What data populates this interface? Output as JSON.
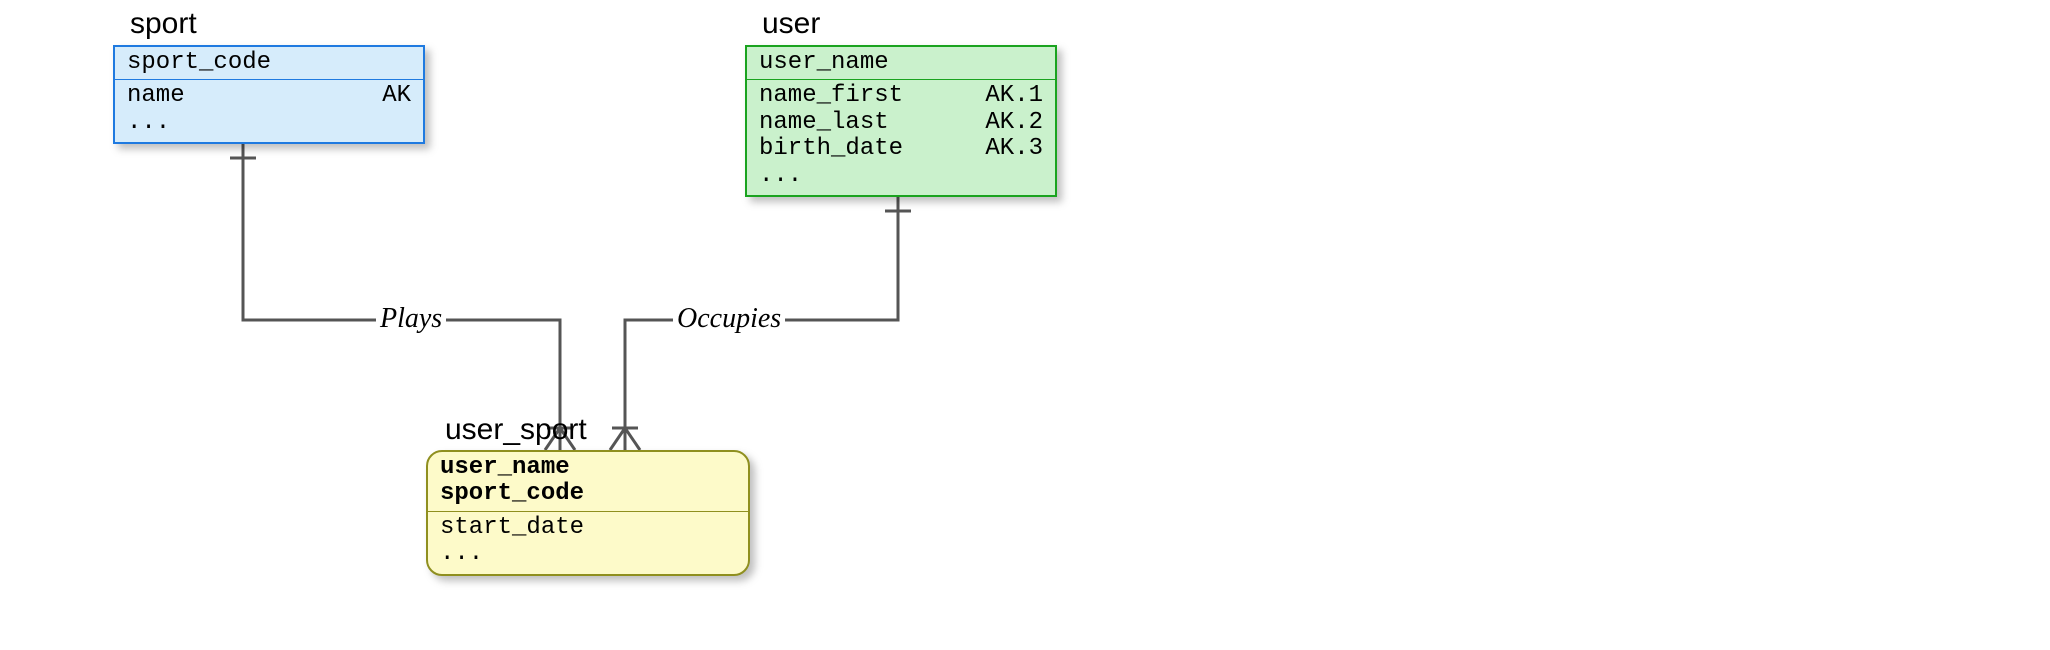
{
  "entities": {
    "sport": {
      "title": "sport",
      "pk": [
        {
          "name": "sport_code",
          "ak": ""
        }
      ],
      "attrs": [
        {
          "name": "name",
          "ak": "AK"
        },
        {
          "name": "...",
          "ak": ""
        }
      ],
      "color": {
        "fill": "#d6ecfb",
        "stroke": "#1f7ae0"
      }
    },
    "user": {
      "title": "user",
      "pk": [
        {
          "name": "user_name",
          "ak": ""
        }
      ],
      "attrs": [
        {
          "name": "name_first",
          "ak": "AK.1"
        },
        {
          "name": "name_last",
          "ak": "AK.2"
        },
        {
          "name": "birth_date",
          "ak": "AK.3"
        },
        {
          "name": "...",
          "ak": ""
        }
      ],
      "color": {
        "fill": "#caf1cc",
        "stroke": "#1aa31f"
      }
    },
    "user_sport": {
      "title": "user_sport",
      "pk": [
        {
          "name": "user_name",
          "ak": ""
        },
        {
          "name": "sport_code",
          "ak": ""
        }
      ],
      "attrs": [
        {
          "name": "start_date",
          "ak": ""
        },
        {
          "name": "...",
          "ak": ""
        }
      ],
      "color": {
        "fill": "#fdfac9",
        "stroke": "#8f8f1f"
      }
    }
  },
  "relationships": {
    "plays": {
      "label": "Plays",
      "from": "sport",
      "to": "user_sport"
    },
    "occupies": {
      "label": "Occupies",
      "from": "user",
      "to": "user_sport"
    }
  }
}
